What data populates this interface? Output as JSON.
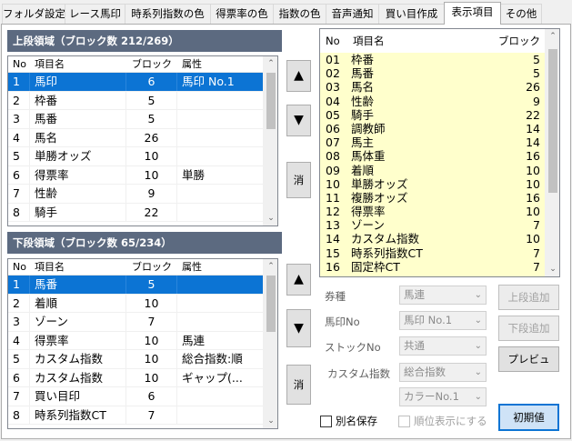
{
  "tabs": [
    {
      "label": "フォルダ設定"
    },
    {
      "label": "レース馬印"
    },
    {
      "label": "時系列指数の色"
    },
    {
      "label": "得票率の色"
    },
    {
      "label": "指数の色"
    },
    {
      "label": "音声通知"
    },
    {
      "label": "買い目作成"
    },
    {
      "label": "表示項目"
    },
    {
      "label": "その他"
    }
  ],
  "upper": {
    "title": "上段領域（ブロック数 212/269）",
    "headers": {
      "no": "No",
      "name": "項目名",
      "blocks": "ブロック",
      "attr": "属性"
    },
    "rows": [
      {
        "no": "1",
        "name": "馬印",
        "blocks": "6",
        "attr": "馬印 No.1"
      },
      {
        "no": "2",
        "name": "枠番",
        "blocks": "5",
        "attr": ""
      },
      {
        "no": "3",
        "name": "馬番",
        "blocks": "5",
        "attr": ""
      },
      {
        "no": "4",
        "name": "馬名",
        "blocks": "26",
        "attr": ""
      },
      {
        "no": "5",
        "name": "単勝オッズ",
        "blocks": "10",
        "attr": ""
      },
      {
        "no": "6",
        "name": "得票率",
        "blocks": "10",
        "attr": "単勝"
      },
      {
        "no": "7",
        "name": "性齢",
        "blocks": "9",
        "attr": ""
      },
      {
        "no": "8",
        "name": "騎手",
        "blocks": "22",
        "attr": ""
      }
    ]
  },
  "lower": {
    "title": "下段領域（ブロック数 65/234）",
    "headers": {
      "no": "No",
      "name": "項目名",
      "blocks": "ブロック",
      "attr": "属性"
    },
    "rows": [
      {
        "no": "1",
        "name": "馬番",
        "blocks": "5",
        "attr": ""
      },
      {
        "no": "2",
        "name": "着順",
        "blocks": "10",
        "attr": ""
      },
      {
        "no": "3",
        "name": "ゾーン",
        "blocks": "7",
        "attr": ""
      },
      {
        "no": "4",
        "name": "得票率",
        "blocks": "10",
        "attr": "馬連"
      },
      {
        "no": "5",
        "name": "カスタム指数",
        "blocks": "10",
        "attr": "総合指数:順"
      },
      {
        "no": "6",
        "name": "カスタム指数",
        "blocks": "10",
        "attr": "ギャップ(..."
      },
      {
        "no": "7",
        "name": "買い目印",
        "blocks": "6",
        "attr": ""
      },
      {
        "no": "8",
        "name": "時系列指数CT",
        "blocks": "7",
        "attr": ""
      }
    ]
  },
  "buttons": {
    "up": "▲",
    "down": "▼",
    "delete": "消",
    "add_upper": "上段追加",
    "add_lower": "下段追加",
    "preview": "プレビュ",
    "reset": "初期値"
  },
  "available": {
    "headers": {
      "no": "No",
      "name": "項目名",
      "blocks": "ブロック"
    },
    "rows": [
      {
        "no": "01",
        "name": "枠番",
        "blocks": "5"
      },
      {
        "no": "02",
        "name": "馬番",
        "blocks": "5"
      },
      {
        "no": "03",
        "name": "馬名",
        "blocks": "26"
      },
      {
        "no": "04",
        "name": "性齢",
        "blocks": "9"
      },
      {
        "no": "05",
        "name": "騎手",
        "blocks": "22"
      },
      {
        "no": "06",
        "name": "調教師",
        "blocks": "14"
      },
      {
        "no": "07",
        "name": "馬主",
        "blocks": "14"
      },
      {
        "no": "08",
        "name": "馬体重",
        "blocks": "16"
      },
      {
        "no": "09",
        "name": "着順",
        "blocks": "10"
      },
      {
        "no": "10",
        "name": "単勝オッズ",
        "blocks": "10"
      },
      {
        "no": "11",
        "name": "複勝オッズ",
        "blocks": "16"
      },
      {
        "no": "12",
        "name": "得票率",
        "blocks": "10"
      },
      {
        "no": "13",
        "name": "ゾーン",
        "blocks": "7"
      },
      {
        "no": "14",
        "name": "カスタム指数",
        "blocks": "10"
      },
      {
        "no": "15",
        "name": "時系列指数CT",
        "blocks": "7"
      },
      {
        "no": "16",
        "name": "固定枠CT",
        "blocks": "7"
      }
    ]
  },
  "form": {
    "ticket_type_label": "券種",
    "ticket_type_value": "馬連",
    "mark_no_label": "馬印No",
    "mark_no_value": "馬印 No.1",
    "stock_no_label": "ストックNo",
    "stock_no_value": "共通",
    "custom_index_label": "カスタム指数",
    "custom_index_value": "総合指数",
    "color_value": "カラーNo.1",
    "alias_save_label": "別名保存",
    "show_rank_label": "順位表示にする"
  },
  "colors": {
    "selection": "#0c74d4",
    "section_header": "#5c6a80",
    "available_list_bg": "#ffffcc"
  }
}
